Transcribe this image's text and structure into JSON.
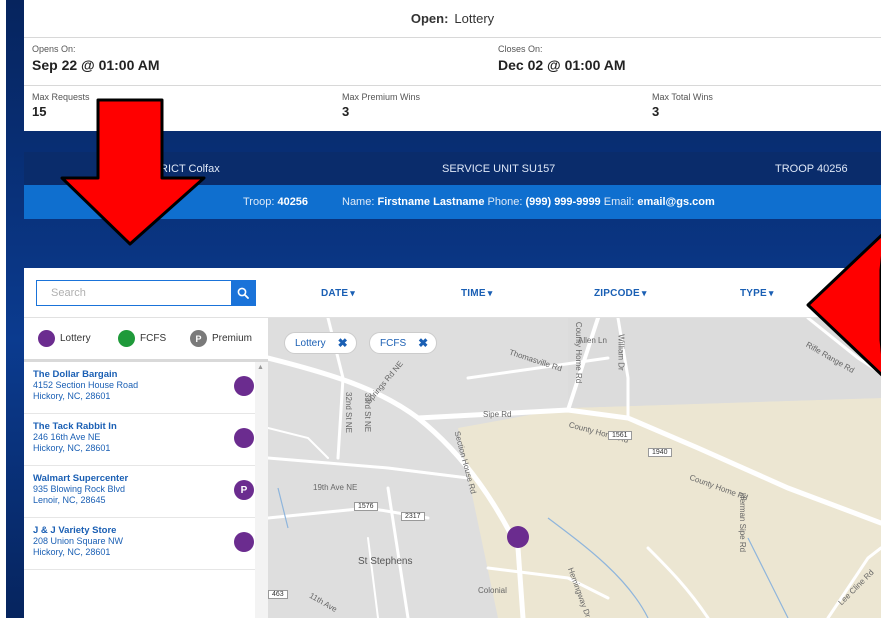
{
  "info": {
    "open_label": "Open:",
    "open_value": "Lottery",
    "opens_on_label": "Opens On:",
    "opens_on_value": "Sep 22 @ 01:00 AM",
    "closes_on_label": "Closes On:",
    "closes_on_value": "Dec 02 @ 01:00 AM",
    "max_requests_label": "Max Requests",
    "max_requests_value": "15",
    "max_premium_label": "Max Premium Wins",
    "max_premium_value": "3",
    "max_total_label": "Max Total Wins",
    "max_total_value": "3"
  },
  "band1": {
    "district": "RICT Colfax",
    "service_unit": "SERVICE UNIT SU157",
    "troop": "TROOP 40256"
  },
  "band2": {
    "troop_label": "Troop:",
    "troop_value": "40256",
    "name_label": "Name:",
    "name_value": "Firstname Lastname",
    "phone_label": "Phone:",
    "phone_value": "(999) 999-9999",
    "email_label": "Email:",
    "email_value": "email@gs.com"
  },
  "search": {
    "placeholder": "Search"
  },
  "filters": {
    "date": "DATE",
    "time": "TIME",
    "zipcode": "ZIPCODE",
    "type": "TYPE"
  },
  "legend": {
    "lottery": "Lottery",
    "fcfs": "FCFS",
    "premium": "Premium",
    "premium_letter": "P"
  },
  "locations": [
    {
      "name": "The Dollar Bargain",
      "street": "4152 Section House Road",
      "city": "Hickory, NC, 28601",
      "marker": ""
    },
    {
      "name": "The Tack Rabbit In",
      "street": "246 16th Ave NE",
      "city": "Hickory, NC, 28601",
      "marker": ""
    },
    {
      "name": "Walmart Supercenter",
      "street": "935 Blowing Rock Blvd",
      "city": "Lenoir, NC, 28645",
      "marker": "P"
    },
    {
      "name": "J & J Variety Store",
      "street": "208 Union Square NW",
      "city": "Hickory, NC, 28601",
      "marker": ""
    }
  ],
  "chips": {
    "lottery": "Lottery",
    "fcfs": "FCFS"
  },
  "map_labels": {
    "allen_ln": "Allen Ln",
    "thomasville": "Thomasville Rd",
    "county_home": "County Home Rd",
    "sipe": "Sipe Rd",
    "county_home_2": "County Home Rd",
    "county_home_3": "County Home Rd",
    "section_house": "Section House Rd",
    "springs": "Springs Rd NE",
    "nineteenth": "19th Ave NE",
    "st_stephens": "St Stephens",
    "rifle_range": "Rifle Range Rd",
    "hermans": "Herman Sipe Rd",
    "lee_cline": "Lee Cline Rd",
    "colonial": "Colonial",
    "hemingway": "Hemingway Dr",
    "willium": "William Dr",
    "thirty_second": "32nd St NE",
    "thirty_third": "33rd St NE",
    "eleventh": "11th Ave",
    "shield_1561": "1561",
    "shield_1940": "1940",
    "shield_1576": "1576",
    "shield_2317": "2317",
    "shield_463": "463"
  },
  "colors": {
    "lottery": "#6b2c8f",
    "fcfs": "#1f9a3a",
    "premium": "#7a7a7a",
    "accent": "#1a73d9",
    "arrow": "#ff0000"
  }
}
